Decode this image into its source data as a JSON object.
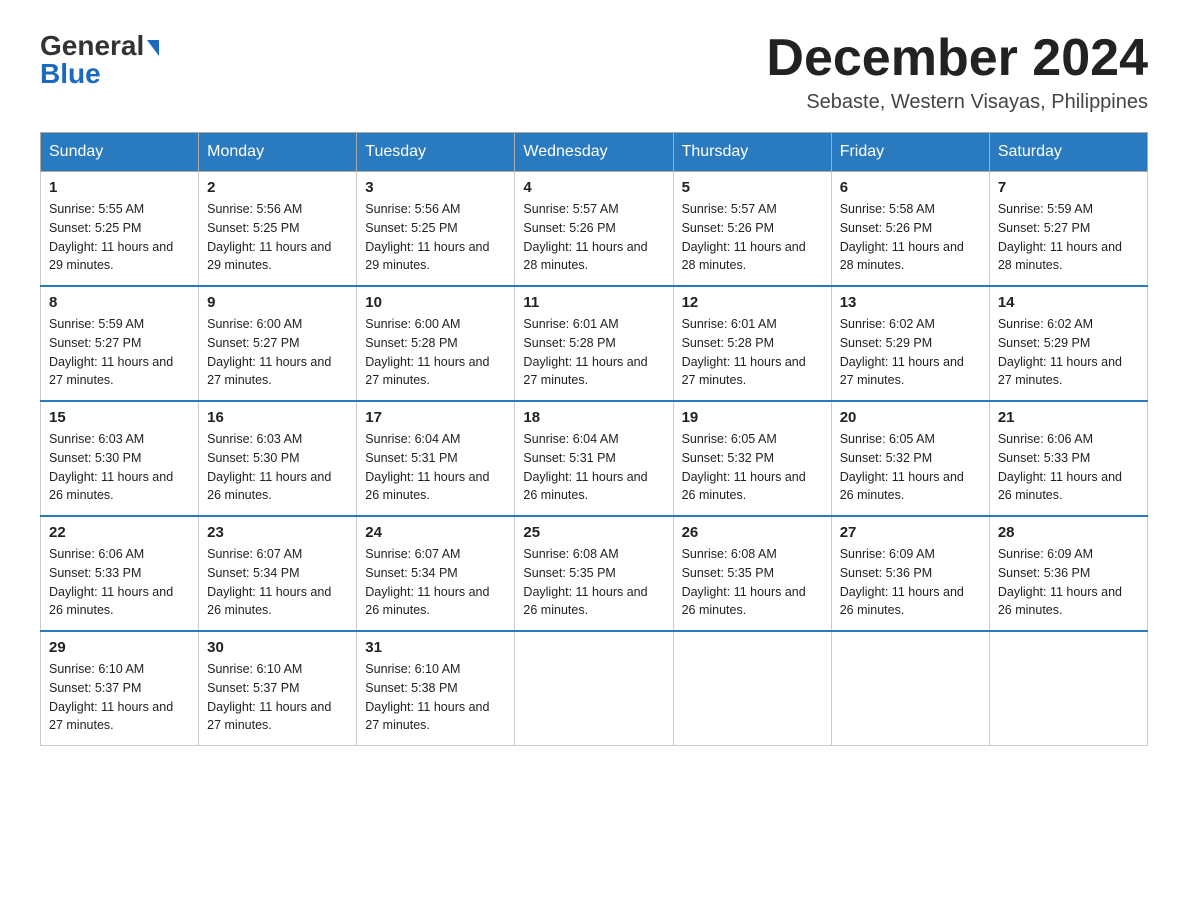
{
  "header": {
    "logo_general": "General",
    "logo_blue": "Blue",
    "month_title": "December 2024",
    "location": "Sebaste, Western Visayas, Philippines"
  },
  "weekdays": [
    "Sunday",
    "Monday",
    "Tuesday",
    "Wednesday",
    "Thursday",
    "Friday",
    "Saturday"
  ],
  "weeks": [
    [
      {
        "day": "1",
        "sunrise": "5:55 AM",
        "sunset": "5:25 PM",
        "daylight": "11 hours and 29 minutes."
      },
      {
        "day": "2",
        "sunrise": "5:56 AM",
        "sunset": "5:25 PM",
        "daylight": "11 hours and 29 minutes."
      },
      {
        "day": "3",
        "sunrise": "5:56 AM",
        "sunset": "5:25 PM",
        "daylight": "11 hours and 29 minutes."
      },
      {
        "day": "4",
        "sunrise": "5:57 AM",
        "sunset": "5:26 PM",
        "daylight": "11 hours and 28 minutes."
      },
      {
        "day": "5",
        "sunrise": "5:57 AM",
        "sunset": "5:26 PM",
        "daylight": "11 hours and 28 minutes."
      },
      {
        "day": "6",
        "sunrise": "5:58 AM",
        "sunset": "5:26 PM",
        "daylight": "11 hours and 28 minutes."
      },
      {
        "day": "7",
        "sunrise": "5:59 AM",
        "sunset": "5:27 PM",
        "daylight": "11 hours and 28 minutes."
      }
    ],
    [
      {
        "day": "8",
        "sunrise": "5:59 AM",
        "sunset": "5:27 PM",
        "daylight": "11 hours and 27 minutes."
      },
      {
        "day": "9",
        "sunrise": "6:00 AM",
        "sunset": "5:27 PM",
        "daylight": "11 hours and 27 minutes."
      },
      {
        "day": "10",
        "sunrise": "6:00 AM",
        "sunset": "5:28 PM",
        "daylight": "11 hours and 27 minutes."
      },
      {
        "day": "11",
        "sunrise": "6:01 AM",
        "sunset": "5:28 PM",
        "daylight": "11 hours and 27 minutes."
      },
      {
        "day": "12",
        "sunrise": "6:01 AM",
        "sunset": "5:28 PM",
        "daylight": "11 hours and 27 minutes."
      },
      {
        "day": "13",
        "sunrise": "6:02 AM",
        "sunset": "5:29 PM",
        "daylight": "11 hours and 27 minutes."
      },
      {
        "day": "14",
        "sunrise": "6:02 AM",
        "sunset": "5:29 PM",
        "daylight": "11 hours and 27 minutes."
      }
    ],
    [
      {
        "day": "15",
        "sunrise": "6:03 AM",
        "sunset": "5:30 PM",
        "daylight": "11 hours and 26 minutes."
      },
      {
        "day": "16",
        "sunrise": "6:03 AM",
        "sunset": "5:30 PM",
        "daylight": "11 hours and 26 minutes."
      },
      {
        "day": "17",
        "sunrise": "6:04 AM",
        "sunset": "5:31 PM",
        "daylight": "11 hours and 26 minutes."
      },
      {
        "day": "18",
        "sunrise": "6:04 AM",
        "sunset": "5:31 PM",
        "daylight": "11 hours and 26 minutes."
      },
      {
        "day": "19",
        "sunrise": "6:05 AM",
        "sunset": "5:32 PM",
        "daylight": "11 hours and 26 minutes."
      },
      {
        "day": "20",
        "sunrise": "6:05 AM",
        "sunset": "5:32 PM",
        "daylight": "11 hours and 26 minutes."
      },
      {
        "day": "21",
        "sunrise": "6:06 AM",
        "sunset": "5:33 PM",
        "daylight": "11 hours and 26 minutes."
      }
    ],
    [
      {
        "day": "22",
        "sunrise": "6:06 AM",
        "sunset": "5:33 PM",
        "daylight": "11 hours and 26 minutes."
      },
      {
        "day": "23",
        "sunrise": "6:07 AM",
        "sunset": "5:34 PM",
        "daylight": "11 hours and 26 minutes."
      },
      {
        "day": "24",
        "sunrise": "6:07 AM",
        "sunset": "5:34 PM",
        "daylight": "11 hours and 26 minutes."
      },
      {
        "day": "25",
        "sunrise": "6:08 AM",
        "sunset": "5:35 PM",
        "daylight": "11 hours and 26 minutes."
      },
      {
        "day": "26",
        "sunrise": "6:08 AM",
        "sunset": "5:35 PM",
        "daylight": "11 hours and 26 minutes."
      },
      {
        "day": "27",
        "sunrise": "6:09 AM",
        "sunset": "5:36 PM",
        "daylight": "11 hours and 26 minutes."
      },
      {
        "day": "28",
        "sunrise": "6:09 AM",
        "sunset": "5:36 PM",
        "daylight": "11 hours and 26 minutes."
      }
    ],
    [
      {
        "day": "29",
        "sunrise": "6:10 AM",
        "sunset": "5:37 PM",
        "daylight": "11 hours and 27 minutes."
      },
      {
        "day": "30",
        "sunrise": "6:10 AM",
        "sunset": "5:37 PM",
        "daylight": "11 hours and 27 minutes."
      },
      {
        "day": "31",
        "sunrise": "6:10 AM",
        "sunset": "5:38 PM",
        "daylight": "11 hours and 27 minutes."
      },
      null,
      null,
      null,
      null
    ]
  ]
}
